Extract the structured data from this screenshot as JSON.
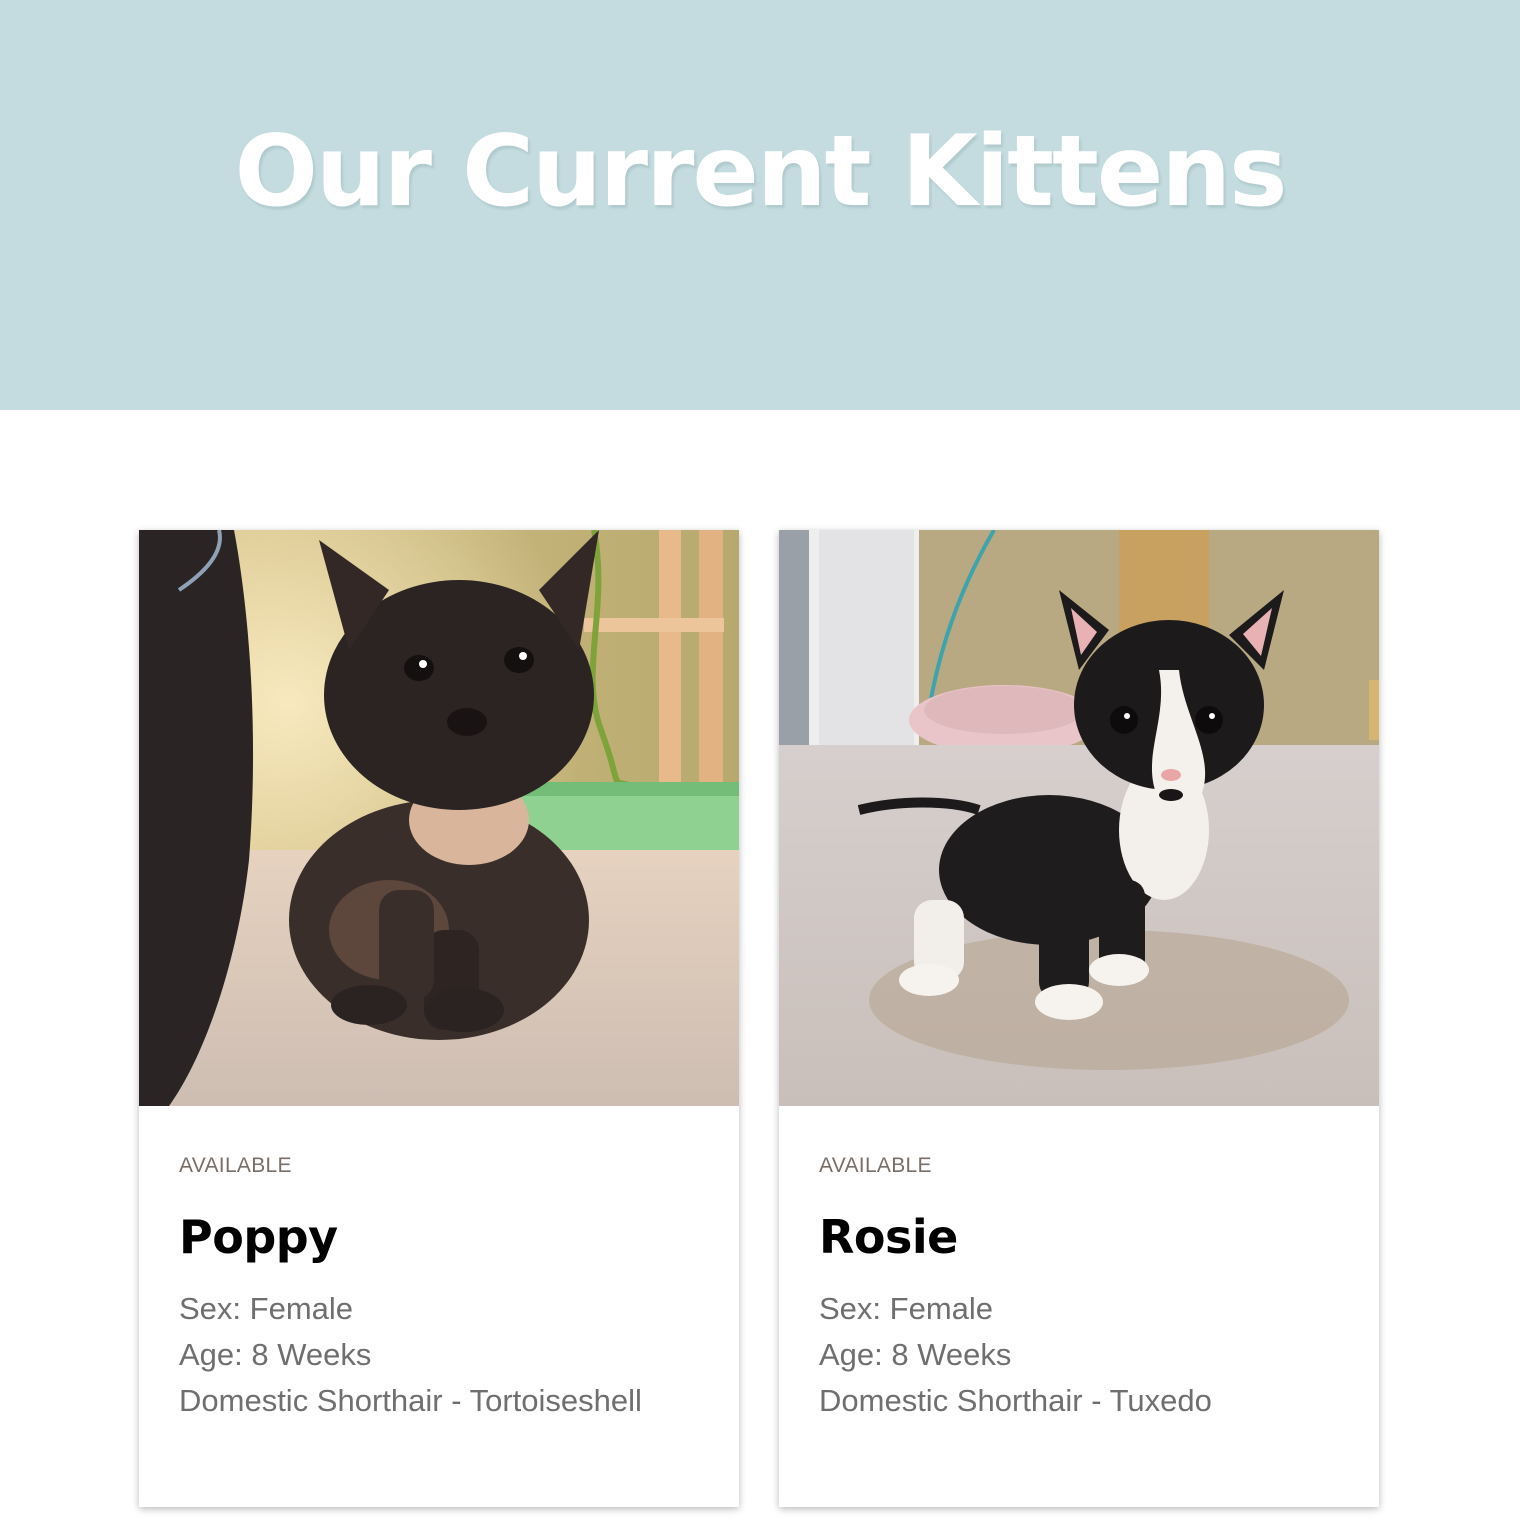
{
  "hero": {
    "title": "Our Current Kittens",
    "background_color": "#c4dcdf"
  },
  "kittens": [
    {
      "status": "AVAILABLE",
      "name": "Poppy",
      "sex": "Sex: Female",
      "age": "Age: 8 Weeks",
      "breed": "Domestic Shorthair - Tortoiseshell",
      "photo": "tortoiseshell-kitten-photo"
    },
    {
      "status": "AVAILABLE",
      "name": "Rosie",
      "sex": "Sex: Female",
      "age": "Age: 8 Weeks",
      "breed": "Domestic Shorthair - Tuxedo",
      "photo": "tuxedo-kitten-photo"
    }
  ]
}
